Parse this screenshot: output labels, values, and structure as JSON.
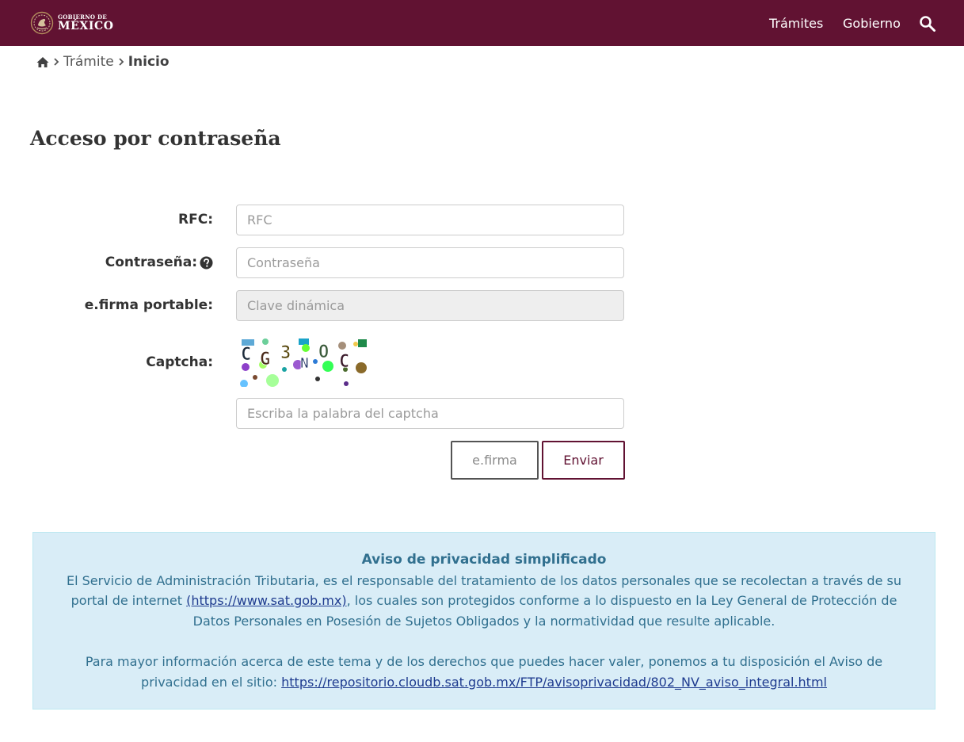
{
  "header": {
    "logo_line1": "GOBIERNO DE",
    "logo_line2": "MÉXICO",
    "nav": [
      "Trámites",
      "Gobierno"
    ],
    "bg_color": "#611232",
    "search_icon": "search-icon"
  },
  "breadcrumb": {
    "home_icon": "home-icon",
    "items": [
      "Trámite",
      "Inicio"
    ]
  },
  "page": {
    "title": "Acceso por contraseña"
  },
  "form": {
    "rfc": {
      "label": "RFC:",
      "placeholder": "RFC",
      "value": ""
    },
    "password": {
      "label": "Contraseña:",
      "placeholder": "Contraseña",
      "value": "",
      "help_icon": "question-circle-icon"
    },
    "efirma_portable": {
      "label": "e.firma portable:",
      "placeholder": "Clave dinámica",
      "value": ""
    },
    "captcha": {
      "label": "Captcha:",
      "text": "CG3NOC",
      "placeholder": "Escriba la palabra del captcha",
      "value": ""
    },
    "buttons": {
      "efirma": "e.firma",
      "submit": "Enviar"
    }
  },
  "notice": {
    "title": "Aviso de privacidad simplificado",
    "p1_text": "El Servicio de Administración Tributaria, es el responsable del tratamiento de los datos personales que se recolectan a través de su portal de internet ",
    "p1_link": "(https://www.sat.gob.mx)",
    "p1_tail": ", los cuales son protegidos conforme a lo dispuesto en la Ley General de Protección de Datos Personales en Posesión de Sujetos Obligados y la normatividad que resulte aplicable.",
    "p2_text": "Para mayor información acerca de este tema y de los derechos que puedes hacer valer, ponemos a tu disposición el Aviso de privacidad en el sitio: ",
    "p2_link": "https://repositorio.cloudb.sat.gob.mx/FTP/avisoprivacidad/802_NV_aviso_integral.html",
    "bg_color": "#d9edf7",
    "text_color": "#31708f"
  }
}
